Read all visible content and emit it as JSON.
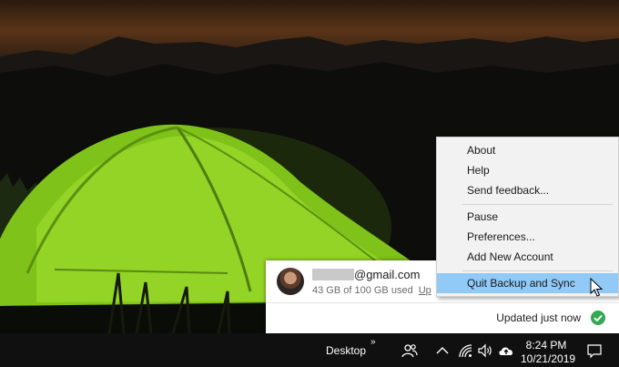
{
  "account": {
    "email_suffix": "@gmail.com",
    "storage_text": "43 GB of 100 GB used",
    "upgrade_link": "Up"
  },
  "status": {
    "text": "Updated just now"
  },
  "menu": {
    "items": [
      {
        "label": "About"
      },
      {
        "label": "Help"
      },
      {
        "label": "Send feedback..."
      },
      {
        "label": "Pause"
      },
      {
        "label": "Preferences..."
      },
      {
        "label": "Add New Account"
      },
      {
        "label": "Quit Backup and Sync"
      }
    ],
    "highlighted_color": "#91c9f7"
  },
  "taskbar": {
    "desktop_label": "Desktop",
    "overflow_chevron": "»",
    "time": "8:24 PM",
    "date": "10/21/2019",
    "icons": [
      "people-icon",
      "chevron-up-icon",
      "wifi-icon",
      "volume-icon",
      "cloud-upload-icon",
      "notification-icon"
    ]
  },
  "colors": {
    "status_check": "#35a853",
    "taskbar_bg": "#101010"
  }
}
